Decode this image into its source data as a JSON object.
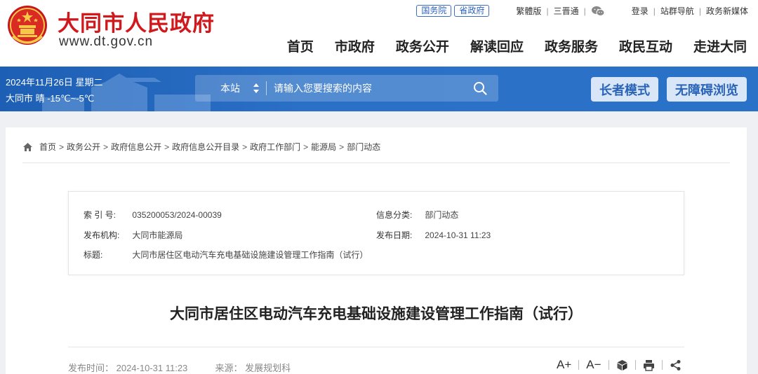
{
  "header": {
    "site_title": "大同市人民政府",
    "site_url": "www.dt.gov.cn",
    "top_pills": [
      "国务院",
      "省政府"
    ],
    "top_links": {
      "traditional": "繁體版",
      "sanjin": "三晋通",
      "login": "登录",
      "site_nav": "站群导航",
      "new_media": "政务新媒体"
    },
    "nav": [
      "首页",
      "市政府",
      "政务公开",
      "解读回应",
      "政务服务",
      "政民互动",
      "走进大同"
    ]
  },
  "band": {
    "date": "2024年11月26日 星期二",
    "weather": "大同市 晴 -15℃~-5℃",
    "search_scope": "本站",
    "search_placeholder": "请输入您要搜索的内容",
    "elder_mode": "长者模式",
    "accessible": "无障碍浏览"
  },
  "breadcrumb": [
    "首页",
    "政务公开",
    "政府信息公开",
    "政府信息公开目录",
    "政府工作部门",
    "能源局",
    "部门动态"
  ],
  "info": {
    "index_label": "索 引 号:",
    "index_value": "035200053/2024-00039",
    "category_label": "信息分类:",
    "category_value": "部门动态",
    "publisher_label": "发布机构:",
    "publisher_value": "大同市能源局",
    "date_label": "发布日期:",
    "date_value": "2024-10-31 11:23",
    "title_label": "标题:",
    "title_value": "大同市居住区电动汽车充电基础设施建设管理工作指南（试行）"
  },
  "article": {
    "title": "大同市居住区电动汽车充电基础设施建设管理工作指南（试行）",
    "published": "发布时间：  2024-10-31 11:23",
    "source": "来源：  发展规划科",
    "font_up": "A+",
    "font_down": "A−"
  },
  "colors": {
    "brand_red": "#d0191d",
    "band_blue": "#2a70c6",
    "link_blue": "#2a60c0"
  }
}
